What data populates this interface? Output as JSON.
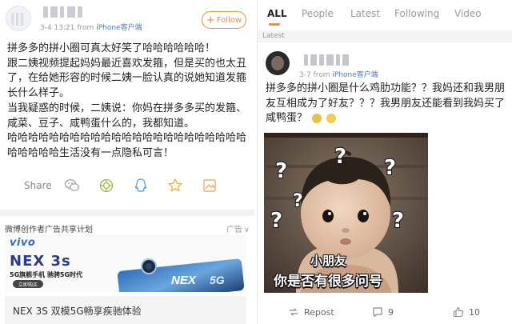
{
  "left_post": {
    "timestamp": "3-4 13:21",
    "source_prefix": "from",
    "source": "iPhone客户端",
    "follow_label": "Follow",
    "body_lines": [
      "拼多多的拼小圈可真太好笑了哈哈哈哈哈哈！",
      "跟二姨视频提起妈妈最近喜欢发箍，但是买的也太丑了，在给她形容的时候二姨一脸认真的说她知道发箍长什么样子。",
      "当我疑惑的时候，二姨说：你妈在拼多多买的发箍、咸菜、豆子、咸鸭蛋什么的，我都知道。",
      "哈哈哈哈哈哈哈哈哈哈哈哈哈哈哈哈哈哈哈哈哈哈哈哈哈哈哈哈生活没有一点隐私可言！"
    ],
    "share_label": "Share",
    "share_icons": [
      "wechat-icon",
      "moments-icon",
      "qq-icon",
      "qzone-icon",
      "save-image-icon"
    ]
  },
  "ad": {
    "plan_label": "微博创作者广告共享计划",
    "ad_tag": "广告",
    "close_glyph": "∨",
    "brand": "vivo",
    "model": "NEX 3s",
    "slogan": "5G旗舰手机  驰骋5G时代",
    "pill": "立即购买",
    "phone_text": "NEX",
    "phone_5g": "5G",
    "caption": "NEX 3S 双模5G畅享疾驰体验"
  },
  "tabs": {
    "items": [
      "ALL",
      "People",
      "Latest",
      "Following",
      "Video"
    ],
    "active": "ALL",
    "accent": "#ef8d3c"
  },
  "right_post": {
    "section_label": "Latest",
    "timestamp": "3-7",
    "source_prefix": "from",
    "source": "iPhone客户端",
    "body": "拼多多的拼小圈是什么鸡肋功能？？我妈还和我男朋友互相成为了好友？？？我男朋友还能看到我妈买了咸鸭蛋？",
    "meme_caption_1": "小朋友",
    "meme_caption_2": "你是否有很多问号",
    "repost_label": "Repost",
    "comment_count": "9",
    "like_count": "10"
  }
}
